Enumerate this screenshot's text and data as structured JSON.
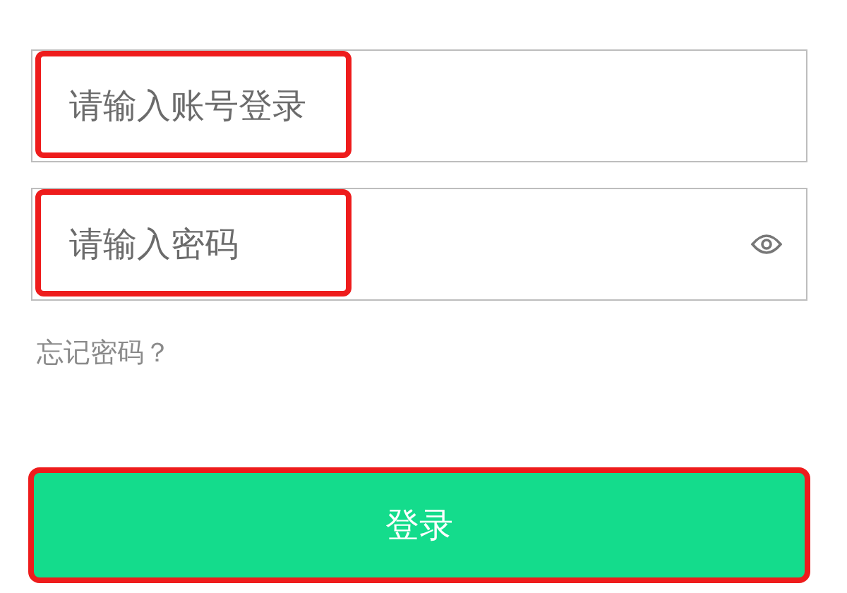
{
  "fields": [
    {
      "kind": "text",
      "placeholder": "请输入账号登录",
      "highlighted": true
    },
    {
      "kind": "password",
      "placeholder": "请输入密码",
      "highlighted": true
    }
  ],
  "forgot_link": "忘记密码？",
  "login_button": {
    "label": "登录",
    "highlighted": true
  }
}
